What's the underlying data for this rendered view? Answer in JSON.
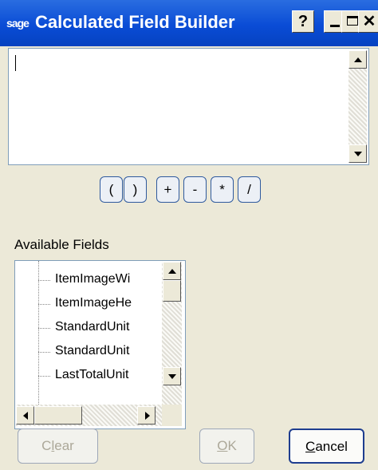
{
  "window": {
    "logo": "sage",
    "title": "Calculated Field Builder",
    "help_label": "?",
    "close_label": "✕"
  },
  "editor": {
    "value": ""
  },
  "operators": [
    "(",
    ")",
    "+",
    "-",
    "*",
    "/"
  ],
  "available_fields": {
    "label": "Available Fields",
    "items": [
      "ItemImageWi",
      "ItemImageHe",
      "StandardUnit",
      "StandardUnit",
      "LastTotalUnit"
    ]
  },
  "buttons": {
    "clear": {
      "pre": "C",
      "key": "l",
      "post": "ear"
    },
    "ok": {
      "pre": "",
      "key": "O",
      "post": "K"
    },
    "cancel": {
      "pre": "",
      "key": "C",
      "post": "ancel"
    }
  },
  "colors": {
    "titlebar": "#0a4cd6",
    "face": "#ece9d8",
    "button_border": "#2f5a9e"
  }
}
